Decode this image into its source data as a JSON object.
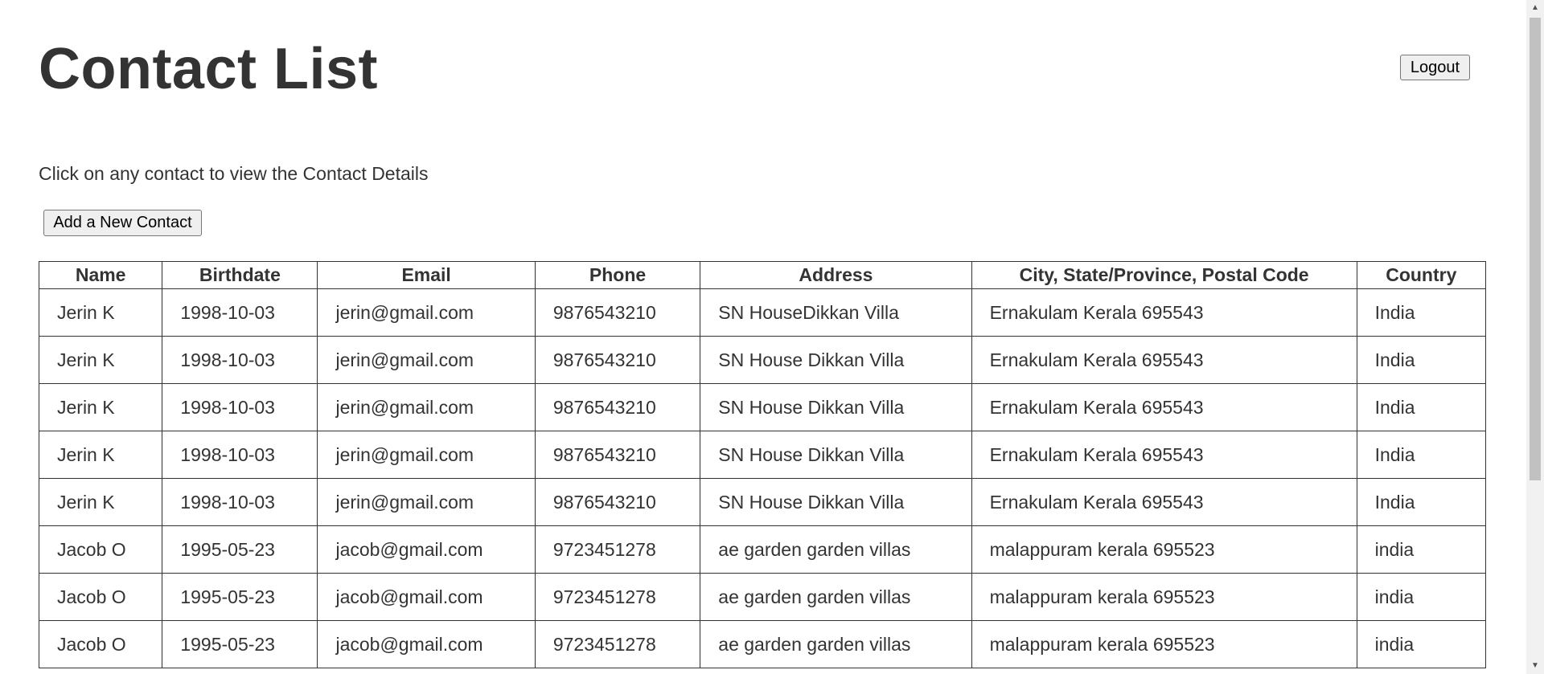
{
  "page": {
    "title": "Contact List",
    "instruction": "Click on any contact to view the Contact Details"
  },
  "buttons": {
    "logout": "Logout",
    "add_contact": "Add a New Contact"
  },
  "table": {
    "headers": [
      "Name",
      "Birthdate",
      "Email",
      "Phone",
      "Address",
      "City, State/Province, Postal Code",
      "Country"
    ],
    "rows": [
      [
        "Jerin K",
        "1998-10-03",
        "jerin@gmail.com",
        "9876543210",
        "SN HouseDikkan Villa",
        "Ernakulam Kerala 695543",
        "India"
      ],
      [
        "Jerin K",
        "1998-10-03",
        "jerin@gmail.com",
        "9876543210",
        "SN House Dikkan Villa",
        "Ernakulam Kerala 695543",
        "India"
      ],
      [
        "Jerin K",
        "1998-10-03",
        "jerin@gmail.com",
        "9876543210",
        "SN House Dikkan Villa",
        "Ernakulam Kerala 695543",
        "India"
      ],
      [
        "Jerin K",
        "1998-10-03",
        "jerin@gmail.com",
        "9876543210",
        "SN House Dikkan Villa",
        "Ernakulam Kerala 695543",
        "India"
      ],
      [
        "Jerin K",
        "1998-10-03",
        "jerin@gmail.com",
        "9876543210",
        "SN House Dikkan Villa",
        "Ernakulam Kerala 695543",
        "India"
      ],
      [
        "Jacob O",
        "1995-05-23",
        "jacob@gmail.com",
        "9723451278",
        "ae garden garden villas",
        "malappuram kerala 695523",
        "india"
      ],
      [
        "Jacob O",
        "1995-05-23",
        "jacob@gmail.com",
        "9723451278",
        "ae garden garden villas",
        "malappuram kerala 695523",
        "india"
      ],
      [
        "Jacob O",
        "1995-05-23",
        "jacob@gmail.com",
        "9723451278",
        "ae garden garden villas",
        "malappuram kerala 695523",
        "india"
      ]
    ]
  },
  "scrollbar": {
    "up_icon": "triangle-up-icon",
    "down_icon": "triangle-down-icon"
  },
  "colors": {
    "text": "#333333",
    "button_bg": "#efefef",
    "button_border": "#767676",
    "table_border": "#333333",
    "scroll_track": "#f1f1f1",
    "scroll_thumb": "#c1c1c1"
  }
}
